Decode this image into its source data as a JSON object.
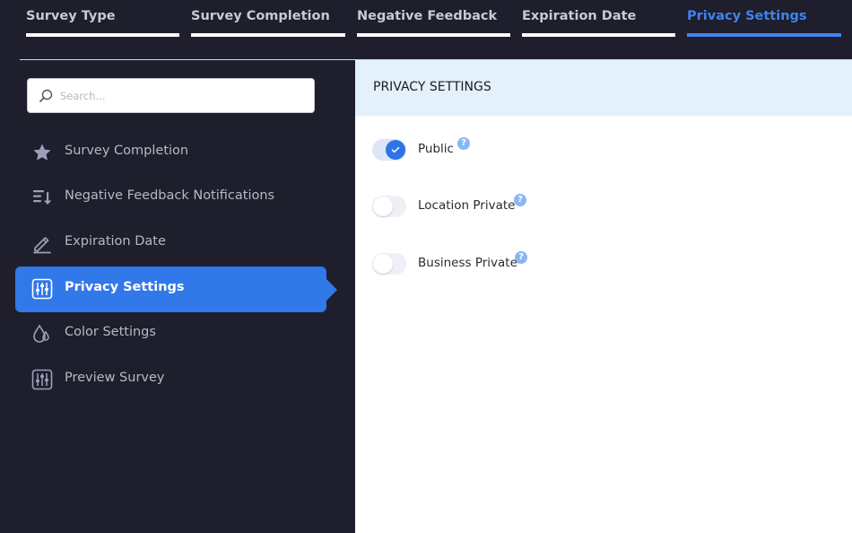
{
  "steps": [
    {
      "label": "Survey Type"
    },
    {
      "label": "Survey Completion"
    },
    {
      "label": "Negative Feedback"
    },
    {
      "label": "Expiration Date"
    },
    {
      "label": "Privacy Settings",
      "active": true
    }
  ],
  "search": {
    "placeholder": "Search..."
  },
  "sidebar": {
    "items": [
      {
        "label": "Survey Completion",
        "icon": "star-icon"
      },
      {
        "label": "Negative Feedback Notifications",
        "icon": "sort-down-icon"
      },
      {
        "label": "Expiration Date",
        "icon": "pencil-icon"
      },
      {
        "label": "Privacy Settings",
        "icon": "sliders-icon",
        "active": true
      },
      {
        "label": "Color Settings",
        "icon": "droplets-icon"
      },
      {
        "label": "Preview Survey",
        "icon": "sliders-icon"
      }
    ]
  },
  "main": {
    "title": "PRIVACY SETTINGS",
    "settings": [
      {
        "label": "Public",
        "enabled": true
      },
      {
        "label": "Location Private",
        "enabled": false
      },
      {
        "label": "Business Private",
        "enabled": false
      }
    ],
    "help_glyph": "?"
  },
  "colors": {
    "accent": "#3178e8",
    "sidebar_bg": "#1e1e2d",
    "header_bg": "#e4f1fa",
    "help_badge": "#8ab6f5"
  }
}
